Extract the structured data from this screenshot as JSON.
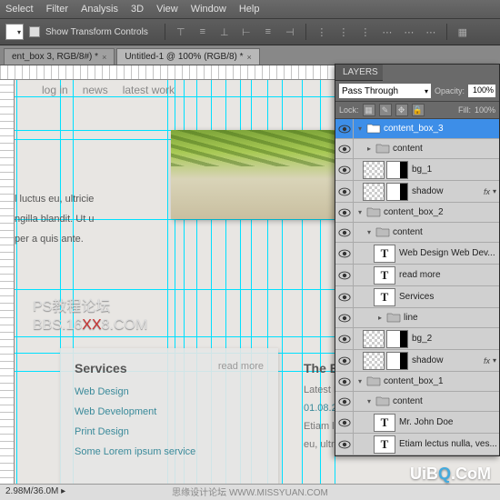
{
  "menu": [
    "Select",
    "Filter",
    "Analysis",
    "3D",
    "View",
    "Window",
    "Help"
  ],
  "optionsbar": {
    "transform_label": "Show Transform Controls"
  },
  "tabs": [
    {
      "label": "ent_box 3, RGB/8#) *"
    },
    {
      "label": "Untitled-1 @ 100% (RGB/8) *"
    }
  ],
  "canvas": {
    "nav": [
      "log in",
      "news",
      "latest work"
    ],
    "body": [
      "l luctus eu, ultricie",
      "ngilla blandit. Ut u",
      "per a quis ante."
    ],
    "watermark1": "PS教程论坛",
    "watermark2a": "BBS.16",
    "watermark2b": "XX",
    "watermark2c": "8.COM",
    "services": {
      "title": "Services",
      "readmore": "read more",
      "items": [
        "Web Design",
        "Web Development",
        "Print Design",
        "Some Lorem ipsum service"
      ]
    },
    "blog": {
      "title": "The Bl",
      "sub": "Latest E",
      "date": "01.08.2",
      "line1": "Etiam le",
      "line2": "eu, ultric"
    }
  },
  "layers": {
    "panel_title": "LAYERS",
    "blend": "Pass Through",
    "opacity_label": "Opacity:",
    "opacity_value": "100%",
    "lock_label": "Lock:",
    "fill_label": "Fill:",
    "fill_value": "100%",
    "items": [
      {
        "t": "group",
        "name": "content_box_3",
        "sel": true,
        "open": true,
        "ind": 0
      },
      {
        "t": "group",
        "name": "content",
        "open": false,
        "ind": 1
      },
      {
        "t": "masked",
        "name": "bg_1",
        "ind": 1
      },
      {
        "t": "masked",
        "name": "shadow",
        "fx": true,
        "ind": 1
      },
      {
        "t": "group",
        "name": "content_box_2",
        "open": true,
        "ind": 0
      },
      {
        "t": "group",
        "name": "content",
        "open": true,
        "ind": 1
      },
      {
        "t": "text",
        "name": "Web Design Web Dev...",
        "ind": 2
      },
      {
        "t": "text",
        "name": "read more",
        "ind": 2
      },
      {
        "t": "text",
        "name": "Services",
        "ind": 2
      },
      {
        "t": "group",
        "name": "line",
        "open": false,
        "ind": 2
      },
      {
        "t": "masked",
        "name": "bg_2",
        "ind": 1
      },
      {
        "t": "masked",
        "name": "shadow",
        "fx": true,
        "ind": 1
      },
      {
        "t": "group",
        "name": "content_box_1",
        "open": true,
        "ind": 0
      },
      {
        "t": "group",
        "name": "content",
        "open": true,
        "ind": 1
      },
      {
        "t": "text",
        "name": "Mr. John Doe",
        "ind": 2
      },
      {
        "t": "text",
        "name": "Etiam lectus nulla, ves...",
        "ind": 2
      }
    ]
  },
  "status": "2.98M/36.0M",
  "footer_wm1": "UiB",
  "footer_wm2": "Q",
  "footer_wm3": ".CoM",
  "footer_txt": "思缘设计论坛   WWW.MISSYUAN.COM"
}
